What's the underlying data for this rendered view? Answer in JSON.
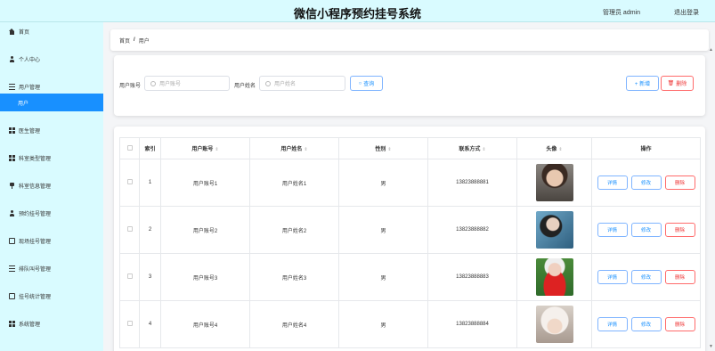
{
  "header": {
    "title": "微信小程序预约挂号系统",
    "user": "管理员 admin",
    "logout": "退出登录"
  },
  "sidebar": {
    "items": [
      {
        "label": "首页",
        "icon": "home-icon"
      },
      {
        "label": "个人中心",
        "icon": "person-icon"
      },
      {
        "label": "用户管理",
        "icon": "list-icon"
      },
      {
        "label": "用户",
        "icon": ""
      },
      {
        "label": "医生管理",
        "icon": "grid-icon"
      },
      {
        "label": "科室类型管理",
        "icon": "grid-icon"
      },
      {
        "label": "科室信息管理",
        "icon": "pin-icon"
      },
      {
        "label": "预约挂号管理",
        "icon": "person-icon"
      },
      {
        "label": "现场挂号管理",
        "icon": "box-icon"
      },
      {
        "label": "排队叫号管理",
        "icon": "list-icon"
      },
      {
        "label": "挂号统计管理",
        "icon": "box-icon"
      },
      {
        "label": "系统管理",
        "icon": "grid-icon"
      }
    ]
  },
  "breadcrumb": {
    "home": "首页",
    "sep": "/",
    "current": "用户"
  },
  "search": {
    "account_label": "用户账号",
    "account_placeholder": "用户账号",
    "name_label": "用户姓名",
    "name_placeholder": "用户姓名",
    "query_btn": "查询",
    "add_btn": "+ 新增",
    "delete_btn": "删除"
  },
  "table": {
    "headers": [
      "",
      "索引",
      "用户账号",
      "用户姓名",
      "性别",
      "联系方式",
      "头像",
      "操作"
    ],
    "rows": [
      {
        "index": "1",
        "account": "用户账号1",
        "name": "用户姓名1",
        "gender": "男",
        "phone": "13823888881"
      },
      {
        "index": "2",
        "account": "用户账号2",
        "name": "用户姓名2",
        "gender": "男",
        "phone": "13823888882"
      },
      {
        "index": "3",
        "account": "用户账号3",
        "name": "用户姓名3",
        "gender": "男",
        "phone": "13823888883"
      },
      {
        "index": "4",
        "account": "用户账号4",
        "name": "用户姓名4",
        "gender": "男",
        "phone": "13823888884"
      }
    ],
    "op_detail": "详情",
    "op_edit": "修改",
    "op_delete": "删除"
  },
  "colors": {
    "accent": "#1890ff",
    "danger": "#ff4d4f",
    "sidebar_bg": "#d9fbff"
  }
}
